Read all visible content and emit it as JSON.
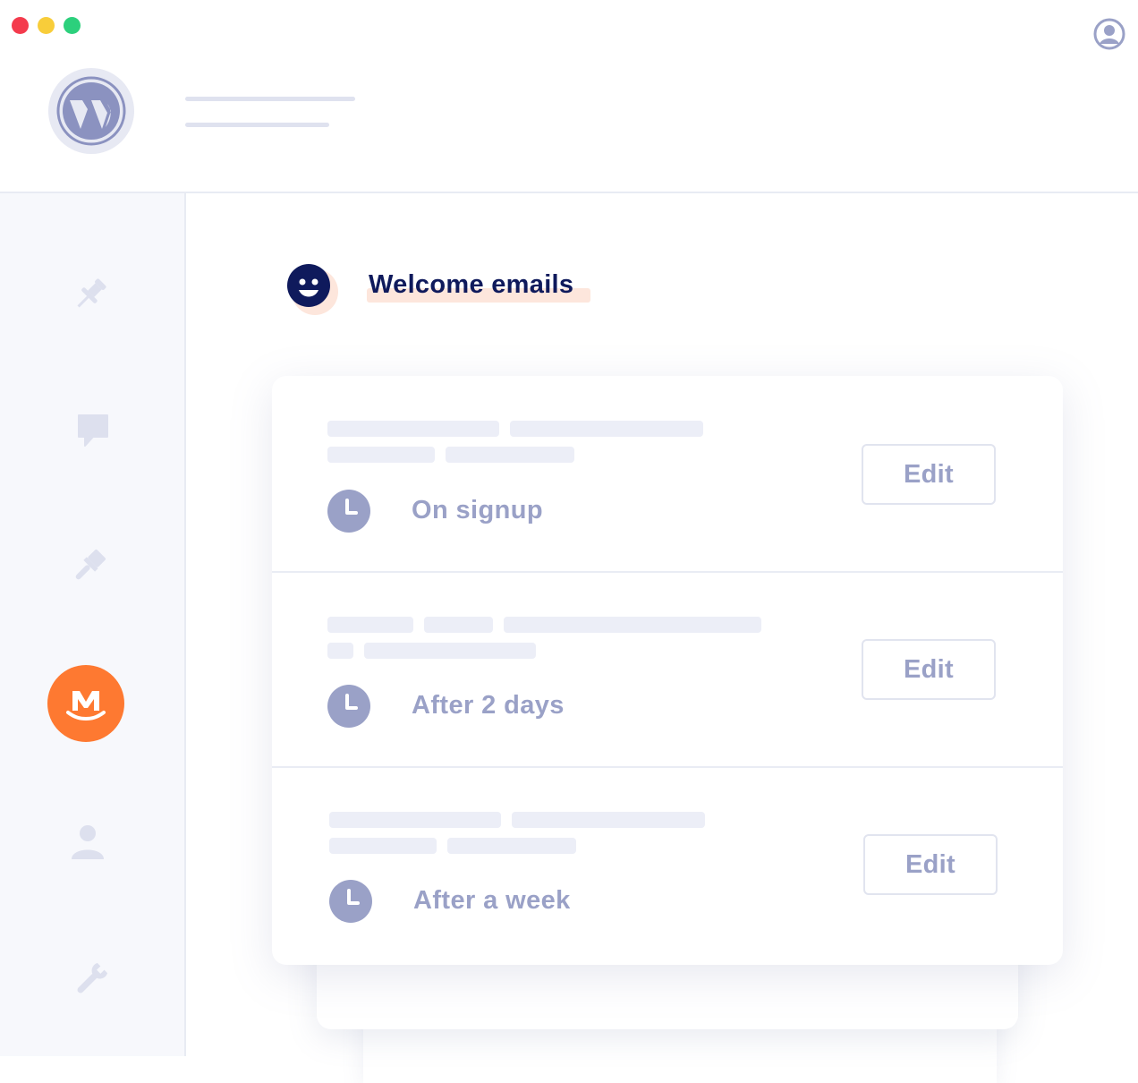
{
  "window": {
    "controls": [
      "close",
      "minimize",
      "maximize"
    ],
    "colors": {
      "close": "#f43b4d",
      "minimize": "#f8cd3a",
      "maximize": "#2cd07c"
    }
  },
  "header": {
    "logo_icon": "wordpress-logo",
    "account_icon": "user-circle-icon"
  },
  "sidebar": {
    "items": [
      {
        "icon": "pin-icon"
      },
      {
        "icon": "comment-icon"
      },
      {
        "icon": "paintbrush-icon"
      },
      {
        "icon": "mailpoet-logo",
        "active": true,
        "color": "#fe7931"
      },
      {
        "icon": "user-icon"
      },
      {
        "icon": "wrench-icon"
      }
    ]
  },
  "main": {
    "title": "Welcome emails",
    "title_icon": "smiley-icon",
    "emails": [
      {
        "timing": "On signup",
        "edit_label": "Edit",
        "icon": "clock-icon"
      },
      {
        "timing": "After 2 days",
        "edit_label": "Edit",
        "icon": "clock-icon"
      },
      {
        "timing": "After a week",
        "edit_label": "Edit",
        "icon": "clock-icon"
      }
    ]
  },
  "colors": {
    "accent": "#fe7931",
    "title": "#0f1a5c",
    "muted": "#9aa1c7",
    "placeholder": "#eceef7"
  }
}
